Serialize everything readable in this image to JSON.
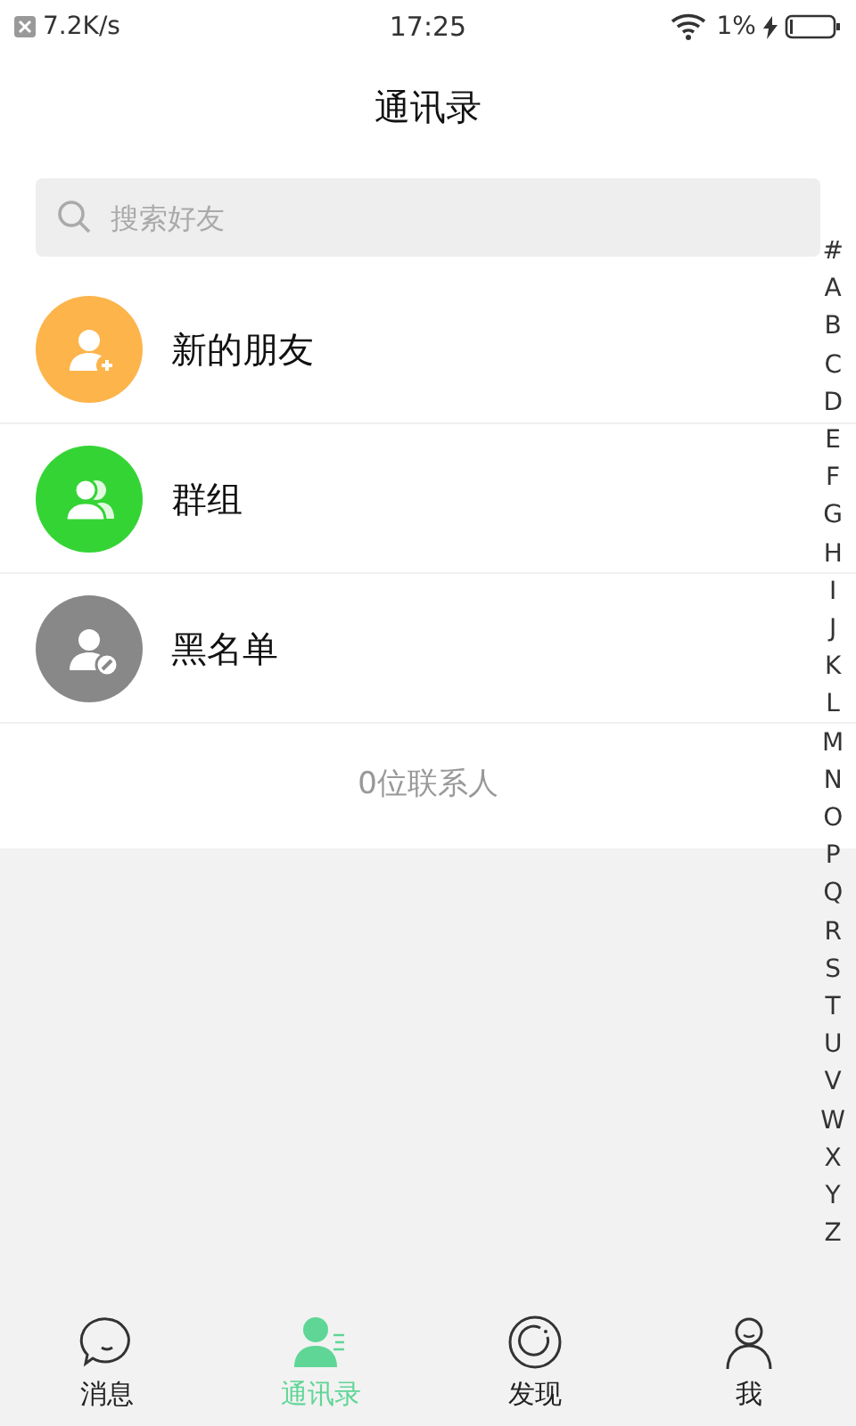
{
  "status_bar": {
    "speed": "7.2K/s",
    "time": "17:25",
    "battery": "1%"
  },
  "title": "通讯录",
  "search": {
    "placeholder": "搜索好友"
  },
  "entries": [
    {
      "kind": "add",
      "label": "新的朋友",
      "color": "#fdb44b"
    },
    {
      "kind": "group",
      "label": "群组",
      "color": "#35d435"
    },
    {
      "kind": "block",
      "label": "黑名单",
      "color": "#888888"
    }
  ],
  "contact_count": "0位联系人",
  "index": [
    "#",
    "A",
    "B",
    "C",
    "D",
    "E",
    "F",
    "G",
    "H",
    "I",
    "J",
    "K",
    "L",
    "M",
    "N",
    "O",
    "P",
    "Q",
    "R",
    "S",
    "T",
    "U",
    "V",
    "W",
    "X",
    "Y",
    "Z"
  ],
  "tabs": [
    {
      "kind": "chat",
      "label": "消息",
      "selected": false
    },
    {
      "kind": "contacts",
      "label": "通讯录",
      "selected": true
    },
    {
      "kind": "discover",
      "label": "发现",
      "selected": false
    },
    {
      "kind": "me",
      "label": "我",
      "selected": false
    }
  ]
}
